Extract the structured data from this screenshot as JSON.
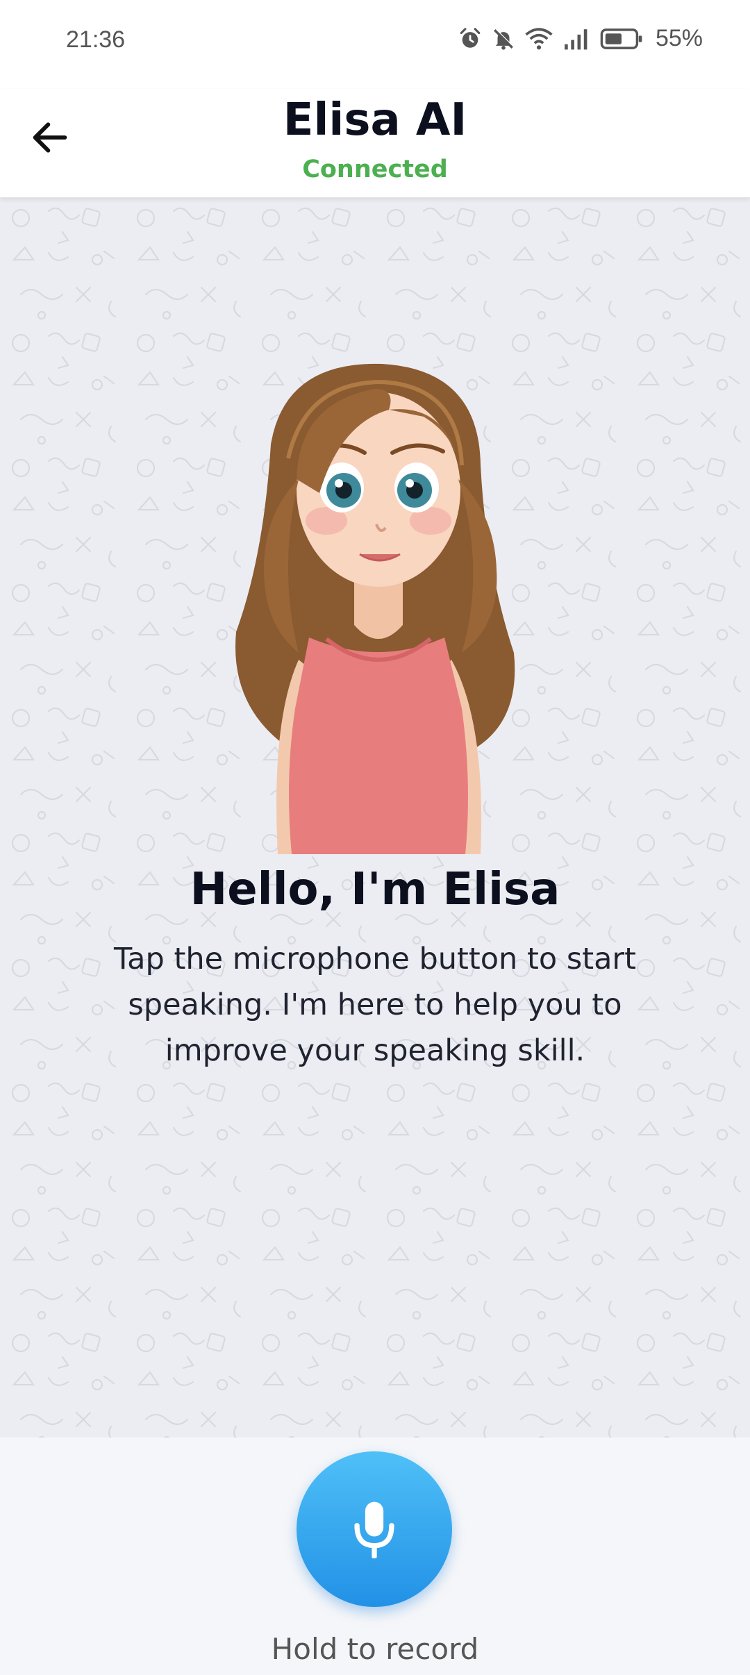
{
  "status_bar": {
    "time": "21:36",
    "battery_percent": "55%",
    "icons": [
      "alarm-icon",
      "mute-icon",
      "wifi-icon",
      "signal-icon",
      "battery-icon"
    ]
  },
  "header": {
    "title": "Elisa AI",
    "connection_status": "Connected",
    "status_color": "#4caf50"
  },
  "main": {
    "avatar_icon": "elisa-avatar",
    "greeting": "Hello, I'm Elisa",
    "intro_text": "Tap the microphone button to start speaking. I'm here to help you to improve your speaking skill."
  },
  "record": {
    "icon": "microphone-icon",
    "label": "Hold to record",
    "accent": "#2a9df0"
  }
}
